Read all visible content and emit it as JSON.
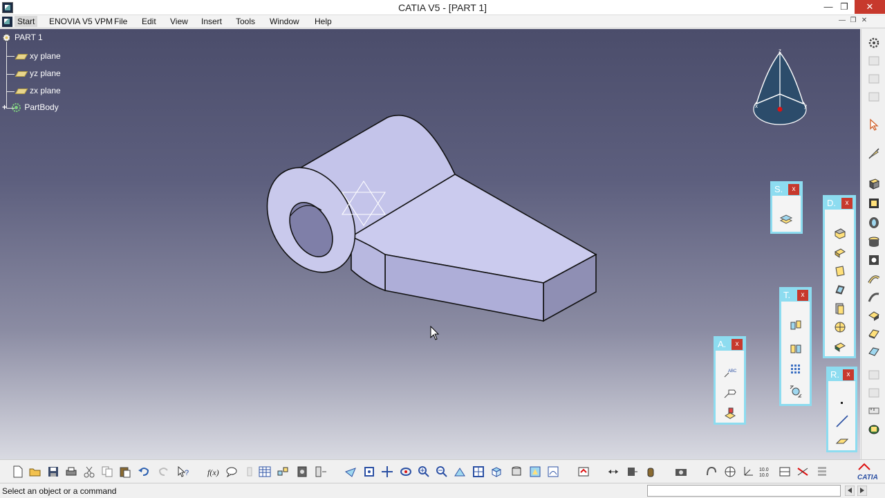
{
  "window": {
    "title": "CATIA V5 - [PART 1]"
  },
  "menu": {
    "items": [
      "Start",
      "ENOVIA V5 VPM",
      "File",
      "Edit",
      "View",
      "Insert",
      "Tools",
      "Window",
      "Help"
    ]
  },
  "tree": {
    "root": "PART 1",
    "planes": [
      "xy plane",
      "yz plane",
      "zx plane"
    ],
    "body": "PartBody"
  },
  "compass": {
    "axes": [
      "z",
      "x",
      "y"
    ]
  },
  "floating_toolbars": {
    "sketcher": {
      "title": "S.",
      "close": "x"
    },
    "dress_up": {
      "title": "D.",
      "close": "x"
    },
    "transformation": {
      "title": "T.",
      "close": "x"
    },
    "annotations": {
      "title": "A.",
      "close": "x",
      "text_icon": "ABC"
    },
    "reference": {
      "title": "R.",
      "close": "x"
    }
  },
  "bottom_toolbar": {
    "brand": "CATIA",
    "zoom_label": "10.0"
  },
  "status": {
    "message": "Select an object or a command",
    "command_input": ""
  },
  "colors": {
    "toolbar_frame": "#8ddcf0",
    "close_red": "#c7392d",
    "part_face": "#c9c9ec"
  }
}
